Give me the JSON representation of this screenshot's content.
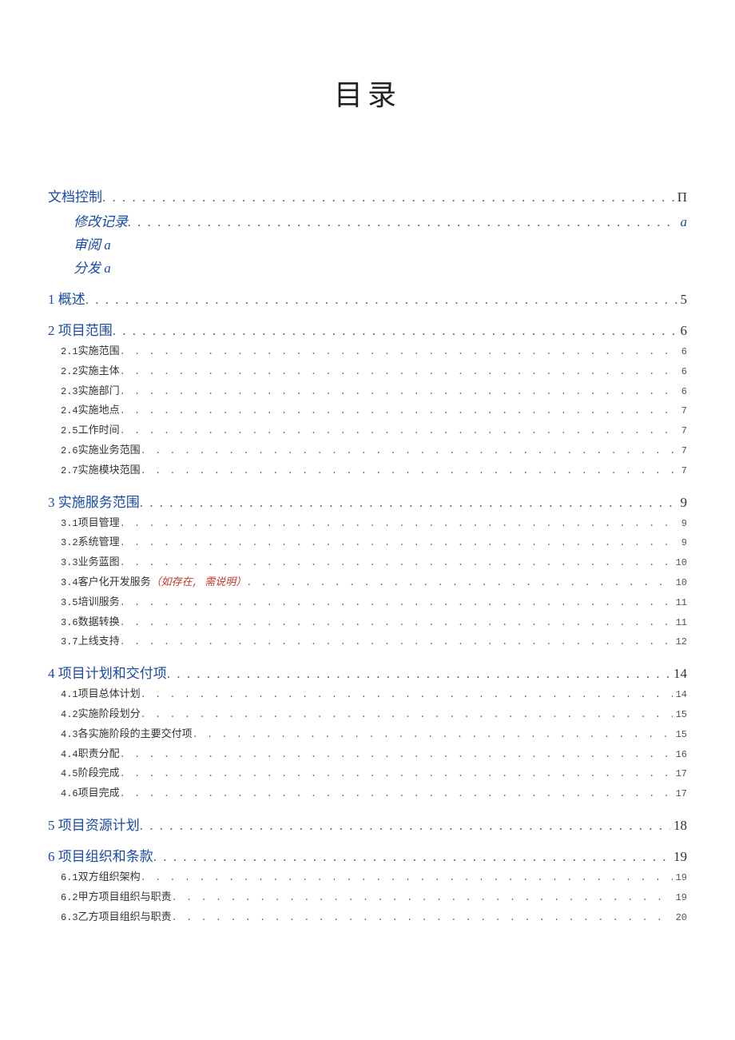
{
  "title": "目录",
  "doc_control": {
    "label": "文档控制",
    "page": "Π"
  },
  "doc_control_sub": [
    {
      "label": "修改记录",
      "page": "a",
      "leader": true
    },
    {
      "label": "审阅",
      "page": "a",
      "leader": false
    },
    {
      "label": "分发",
      "page": "a",
      "leader": false
    }
  ],
  "sections": [
    {
      "num": "1",
      "label": "概述",
      "page": "5",
      "children": []
    },
    {
      "num": "2",
      "label": "项目范围",
      "page": "6",
      "children": [
        {
          "num": "2.1",
          "label": "实施范围",
          "page": "6"
        },
        {
          "num": "2.2",
          "label": "实施主体",
          "page": "6"
        },
        {
          "num": "2.3",
          "label": "实施部门",
          "page": "6"
        },
        {
          "num": "2.4",
          "label": "实施地点",
          "page": "7"
        },
        {
          "num": "2.5",
          "label": "工作时间",
          "page": "7"
        },
        {
          "num": "2.6",
          "label": "实施业务范围",
          "page": "7"
        },
        {
          "num": "2.7",
          "label": "实施模块范围",
          "page": "7"
        }
      ]
    },
    {
      "num": "3",
      "label": "实施服务范围",
      "page": "9",
      "children": [
        {
          "num": "3.1",
          "label": "项目管理",
          "page": "9"
        },
        {
          "num": "3.2",
          "label": "系统管理",
          "page": "9"
        },
        {
          "num": "3.3",
          "label": "业务蓝图",
          "page": "10"
        },
        {
          "num": "3.4",
          "label": "客户化开发服务",
          "note": "（如存在, 需说明）",
          "page": "10"
        },
        {
          "num": "3.5",
          "label": "培训服务",
          "page": "11"
        },
        {
          "num": "3.6",
          "label": "数据转换",
          "page": "11"
        },
        {
          "num": "3.7",
          "label": "上线支持",
          "page": "12"
        }
      ]
    },
    {
      "num": "4",
      "label": "项目计划和交付项",
      "page": "14",
      "children": [
        {
          "num": "4.1",
          "label": "项目总体计划",
          "page": "14"
        },
        {
          "num": "4.2",
          "label": "实施阶段划分",
          "page": "15"
        },
        {
          "num": "4.3",
          "label": "各实施阶段的主要交付项",
          "page": "15"
        },
        {
          "num": "4.4",
          "label": "职责分配",
          "page": "16"
        },
        {
          "num": "4.5",
          "label": "阶段完成",
          "page": "17"
        },
        {
          "num": "4.6",
          "label": "项目完成",
          "page": "17"
        }
      ]
    },
    {
      "num": "5",
      "label": "项目资源计划",
      "page": "18",
      "children": []
    },
    {
      "num": "6",
      "label": "项目组织和条款",
      "page": "19",
      "children": [
        {
          "num": "6.1",
          "label": "双方组织架构",
          "page": "19"
        },
        {
          "num": "6.2",
          "label": "甲方项目组织与职责",
          "page": "19"
        },
        {
          "num": "6.3",
          "label": "乙方项目组织与职责",
          "page": "20"
        }
      ]
    }
  ]
}
